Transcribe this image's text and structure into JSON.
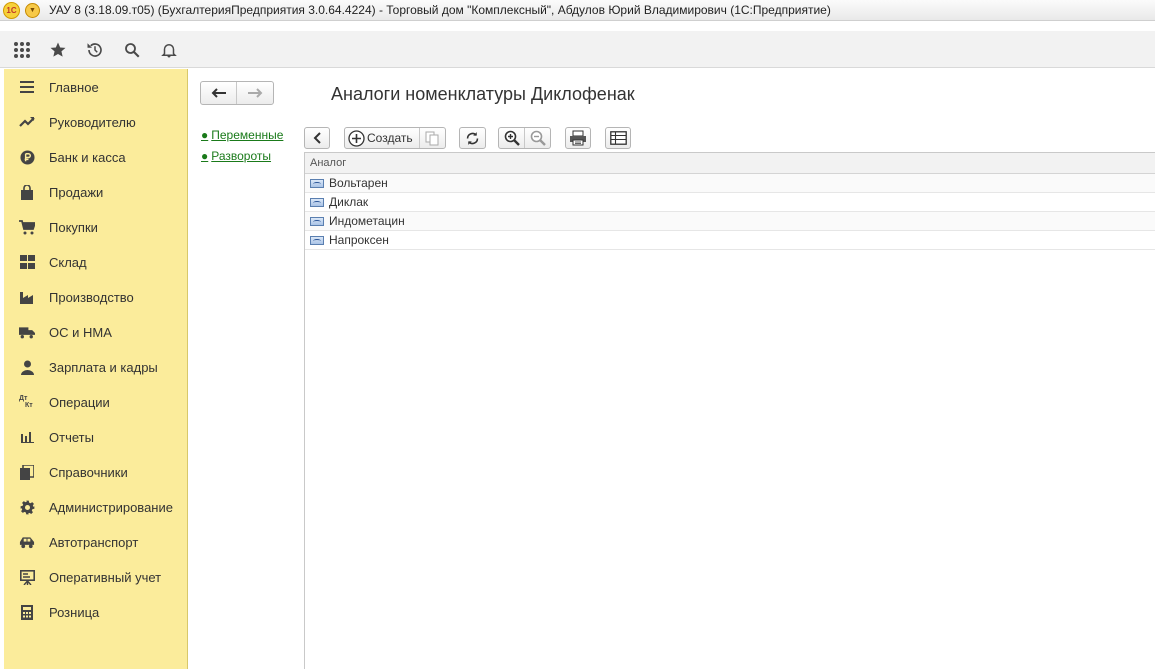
{
  "window": {
    "logo": "1С",
    "title": "УАУ 8 (3.18.09.т05) (БухгалтерияПредприятия 3.0.64.4224) - Торговый дом \"Комплексный\", Абдулов Юрий Владимирович  (1С:Предприятие)"
  },
  "toolbar": {
    "icons": [
      "apps-grid-icon",
      "favorites-star-icon",
      "history-icon",
      "search-icon",
      "notifications-bell-icon"
    ]
  },
  "sidebar": {
    "items": [
      {
        "label": "Главное",
        "icon": "menu-lines-icon"
      },
      {
        "label": "Руководителю",
        "icon": "trend-up-icon"
      },
      {
        "label": "Банк и касса",
        "icon": "ruble-coin-icon"
      },
      {
        "label": "Продажи",
        "icon": "shopping-bag-icon"
      },
      {
        "label": "Покупки",
        "icon": "cart-icon"
      },
      {
        "label": "Склад",
        "icon": "warehouse-grid-icon"
      },
      {
        "label": "Производство",
        "icon": "factory-icon"
      },
      {
        "label": "ОС и НМА",
        "icon": "truck-icon"
      },
      {
        "label": "Зарплата и кадры",
        "icon": "person-icon"
      },
      {
        "label": "Операции",
        "icon": "dt-kt-icon"
      },
      {
        "label": "Отчеты",
        "icon": "bar-chart-icon"
      },
      {
        "label": "Справочники",
        "icon": "books-icon"
      },
      {
        "label": "Администрирование",
        "icon": "gear-icon"
      },
      {
        "label": "Автотранспорт",
        "icon": "car-icon"
      },
      {
        "label": "Оперативный учет",
        "icon": "presentation-icon"
      },
      {
        "label": "Розница",
        "icon": "calculator-icon"
      }
    ],
    "dt_kt_top": "Дт",
    "dt_kt_bottom": "Кт"
  },
  "page": {
    "title": "Аналоги номенклатуры Диклофенак",
    "links": [
      "Переменные",
      "Развороты"
    ],
    "link_bullet": "●"
  },
  "form_toolbar": {
    "create_label": "Создать"
  },
  "table": {
    "column": "Аналог",
    "rows": [
      "Вольтарен",
      "Диклак",
      "Индометацин",
      "Напроксен"
    ]
  }
}
